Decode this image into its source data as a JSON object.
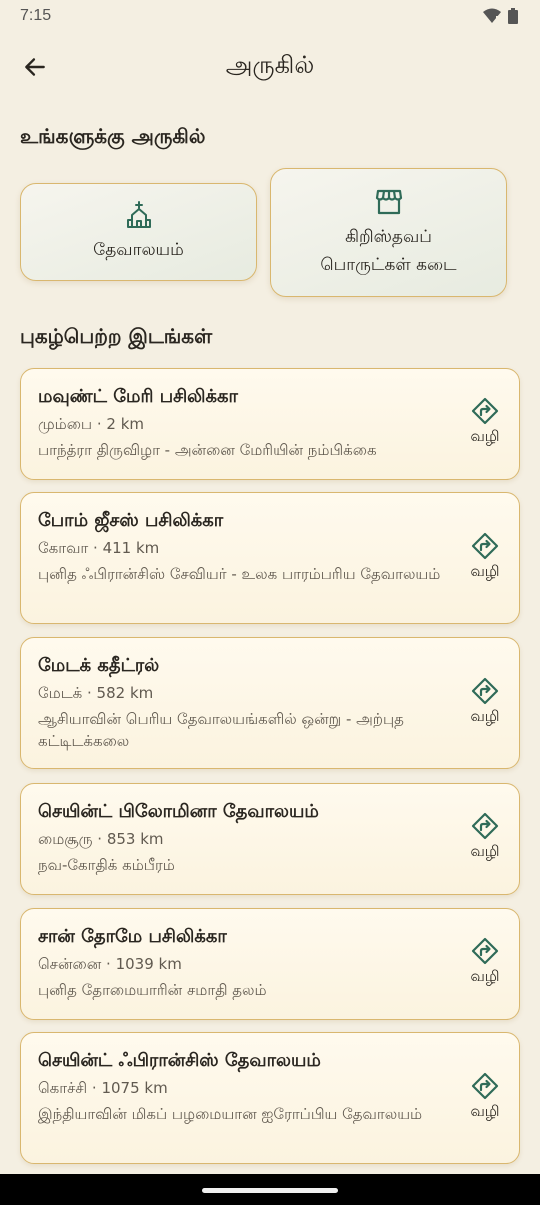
{
  "status_bar": {
    "time": "7:15"
  },
  "app_bar": {
    "title": "அருகில்"
  },
  "nearby": {
    "heading": "உங்களுக்கு அருகில்",
    "categories": [
      {
        "label": "தேவாலயம்",
        "icon": "church-icon"
      },
      {
        "label": "கிறிஸ்தவப்\nபொருட்கள் கடை",
        "icon": "store-icon"
      }
    ]
  },
  "famous": {
    "heading": "புகழ்பெற்ற இடங்கள்",
    "direction_label": "வழி",
    "places": [
      {
        "name": "மவுண்ட் மேரி பசிலிக்கா",
        "meta": "மும்பை · 2 km",
        "desc": "பாந்த்ரா திருவிழா - அன்னை மேரியின் நம்பிக்கை"
      },
      {
        "name": "போம் ஜீசஸ் பசிலிக்கா",
        "meta": "கோவா · 411 km",
        "desc": "புனித ஃபிரான்சிஸ் சேவியர் - உலக பாரம்பரிய தேவாலயம்"
      },
      {
        "name": "மேடக் கதீட்ரல்",
        "meta": "மேடக் · 582 km",
        "desc": "ஆசியாவின் பெரிய தேவாலயங்களில் ஒன்று - அற்புத கட்டிடக்கலை"
      },
      {
        "name": "செயின்ட் பிலோமினா தேவாலயம்",
        "meta": "மைசூரு · 853 km",
        "desc": "நவ-கோதிக் கம்பீரம்"
      },
      {
        "name": "சான் தோமே பசிலிக்கா",
        "meta": "சென்னை · 1039 km",
        "desc": "புனித தோமையாரின் சமாதி தலம்"
      },
      {
        "name": "செயின்ட் ஃபிரான்சிஸ் தேவாலயம்",
        "meta": "கொச்சி · 1075 km",
        "desc": "இந்தியாவின் மிகப் பழமையான ஐரோப்பிய தேவாலயம்"
      }
    ]
  },
  "colors": {
    "background": "#f4efe2",
    "accent_green": "#2f6b58",
    "border_gold": "#d9b76f"
  }
}
